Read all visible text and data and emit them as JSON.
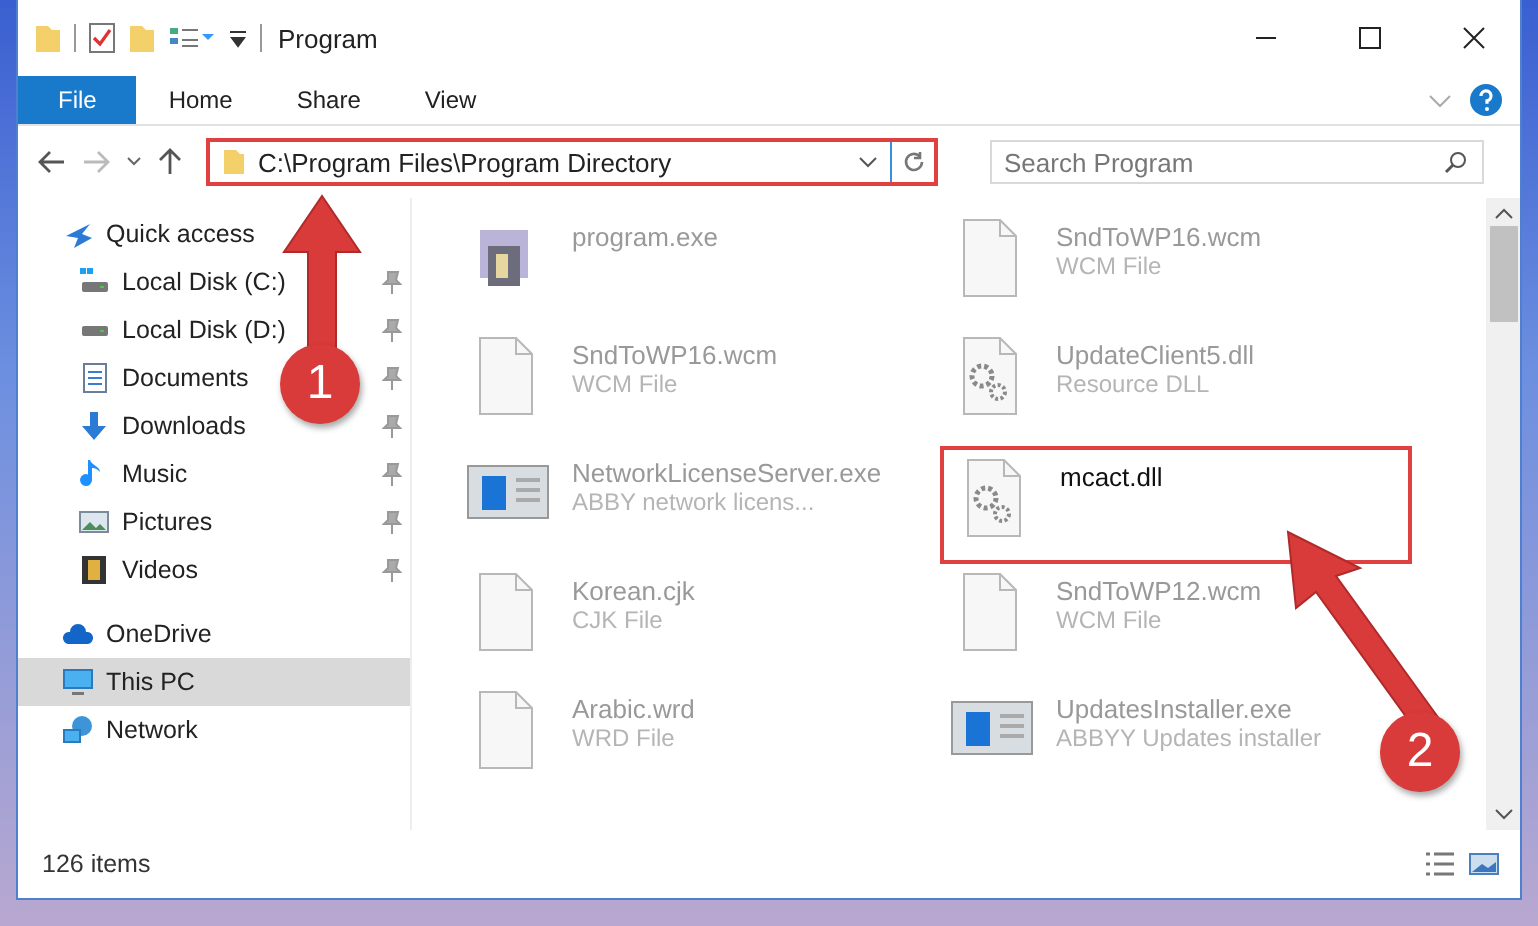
{
  "window": {
    "title": "Program"
  },
  "ribbon_tabs": [
    {
      "label": "File",
      "selected": true
    },
    {
      "label": "Home",
      "selected": false
    },
    {
      "label": "Share",
      "selected": false
    },
    {
      "label": "View",
      "selected": false
    }
  ],
  "address": {
    "value": "C:\\Program Files\\Program Directory",
    "highlighted": true
  },
  "search": {
    "placeholder": "Search Program"
  },
  "sidebar": {
    "items": [
      {
        "label": "Quick access",
        "kind": "star",
        "selected": false,
        "children": [
          {
            "label": "Local Disk (C:)",
            "kind": "drive-win",
            "pinned": true,
            "selected": false
          },
          {
            "label": "Local Disk (D:)",
            "kind": "drive",
            "pinned": true,
            "selected": false
          },
          {
            "label": "Documents",
            "kind": "doc",
            "pinned": true,
            "selected": false
          },
          {
            "label": "Downloads",
            "kind": "download",
            "pinned": true,
            "selected": false
          },
          {
            "label": "Music",
            "kind": "music",
            "pinned": true,
            "selected": false
          },
          {
            "label": "Pictures",
            "kind": "pictures",
            "pinned": true,
            "selected": false
          },
          {
            "label": "Videos",
            "kind": "videos",
            "pinned": true,
            "selected": false
          }
        ]
      },
      {
        "label": "OneDrive",
        "kind": "cloud",
        "selected": false
      },
      {
        "label": "This PC",
        "kind": "pc",
        "selected": true
      },
      {
        "label": "Network",
        "kind": "network",
        "selected": false
      }
    ]
  },
  "files": [
    {
      "name": "program.exe",
      "kind": "exe",
      "highlighted": false
    },
    {
      "name": "SndToWP16.wcm",
      "type": "WCM File",
      "kind": "blank",
      "highlighted": false
    },
    {
      "name": "SndToWP16.wcm",
      "type": "WCM File",
      "kind": "blank",
      "highlighted": false
    },
    {
      "name": "UpdateClient5.dll",
      "type": "Resource DLL",
      "kind": "gear",
      "highlighted": false
    },
    {
      "name": "NetworkLicenseServer.exe",
      "type": "ABBY network licens...",
      "kind": "app",
      "highlighted": false
    },
    {
      "name": "mcact.dll",
      "kind": "gear",
      "highlighted": true
    },
    {
      "name": "Korean.cjk",
      "type": "CJK File",
      "kind": "blank",
      "highlighted": false
    },
    {
      "name": "SndToWP12.wcm",
      "type": "WCM File",
      "kind": "blank",
      "highlighted": false
    },
    {
      "name": "Arabic.wrd",
      "type": "WRD File",
      "kind": "blank",
      "highlighted": false
    },
    {
      "name": "UpdatesInstaller.exe",
      "type": "ABBYY Updates installer",
      "kind": "app",
      "highlighted": false
    }
  ],
  "annotations": [
    {
      "label": "1"
    },
    {
      "label": "2"
    }
  ],
  "status_bar": {
    "count": "126 items"
  }
}
